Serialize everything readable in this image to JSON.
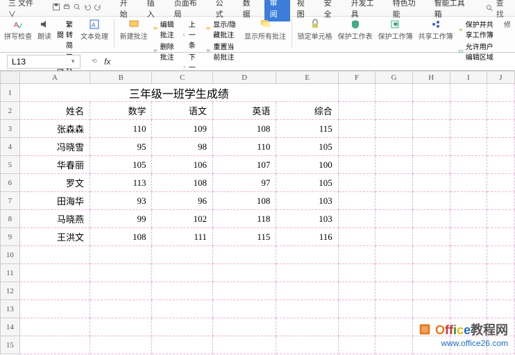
{
  "menubar": {
    "file": "三 文件 ∨",
    "tabs": [
      "开始",
      "插入",
      "页面布局",
      "公式",
      "数据",
      "审阅",
      "视图",
      "安全",
      "开发工具",
      "特色功能",
      "智能工具箱"
    ],
    "active_tab_index": 5,
    "search": "查找"
  },
  "ribbon": {
    "spellcheck": "拼写检查",
    "read": "朗读",
    "simp2trad": "繁转简",
    "trad2simp": "简转繁",
    "textproc": "文本处理",
    "new_comment": "新建批注",
    "edit_comment": "编辑批注",
    "del_comment": "删除批注",
    "prev": "上一条",
    "next": "下一条",
    "show_hide": "显示/隐藏批注",
    "reset": "重置当前批注",
    "show_all": "显示所有批注",
    "lock_cells": "锁定单元格",
    "protect_sheet": "保护工作表",
    "protect_book": "保护工作簿",
    "share_book": "共享工作簿",
    "protect_share": "保护并共享工作簿",
    "allow_edit": "允许用户编辑区域",
    "track": "修"
  },
  "formula_bar": {
    "name_box": "L13",
    "fx": "fx"
  },
  "sheet": {
    "columns": [
      "A",
      "B",
      "C",
      "D",
      "E",
      "F",
      "G",
      "H",
      "I",
      "J"
    ],
    "row_count": 15,
    "title": "三年级一班学生成绩",
    "headers": [
      "姓名",
      "数学",
      "语文",
      "英语",
      "综合"
    ],
    "rows": [
      {
        "name": "张森森",
        "math": "110",
        "chinese": "109",
        "english": "108",
        "comp": "115"
      },
      {
        "name": "冯晓雪",
        "math": "95",
        "chinese": "98",
        "english": "110",
        "comp": "105"
      },
      {
        "name": "华春丽",
        "math": "105",
        "chinese": "106",
        "english": "107",
        "comp": "100"
      },
      {
        "name": "罗文",
        "math": "113",
        "chinese": "108",
        "english": "97",
        "comp": "105"
      },
      {
        "name": "田海华",
        "math": "93",
        "chinese": "96",
        "english": "108",
        "comp": "103"
      },
      {
        "name": "马晓燕",
        "math": "99",
        "chinese": "102",
        "english": "118",
        "comp": "103"
      },
      {
        "name": "王洪文",
        "math": "108",
        "chinese": "111",
        "english": "115",
        "comp": "116"
      }
    ],
    "selected_cell": "L13"
  },
  "watermark": {
    "brand_prefix": "Office",
    "brand_suffix": "教程网",
    "url": "www.office26.com"
  }
}
